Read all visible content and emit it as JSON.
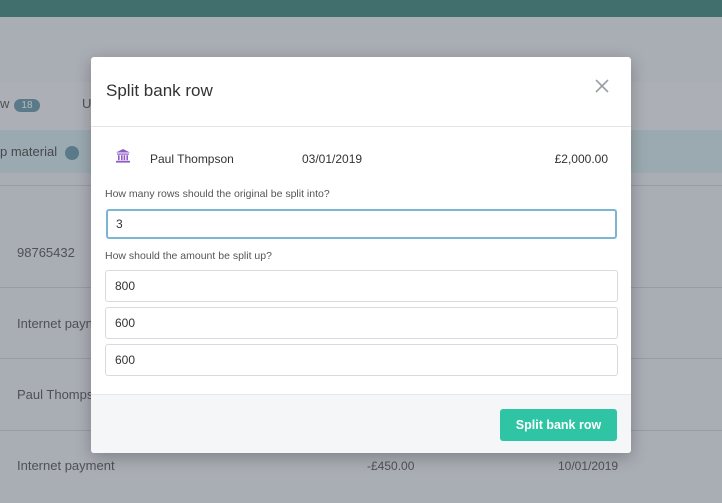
{
  "background": {
    "tabs": [
      {
        "label_fragment": "w",
        "count": "18"
      },
      {
        "label_fragment": "U"
      }
    ],
    "filter": {
      "label_fragment": "p material"
    },
    "rows": [
      {
        "description": "98765432"
      },
      {
        "description": "Internet payn"
      },
      {
        "description": "Paul Thomps"
      },
      {
        "description": "Internet payment",
        "amount": "-£450.00",
        "date": "10/01/2019"
      }
    ]
  },
  "modal": {
    "title": "Split bank row",
    "transaction": {
      "icon": "bank-icon",
      "name": "Paul Thompson",
      "date": "03/01/2019",
      "amount": "£2,000.00"
    },
    "rows_question": "How many rows should the original be split into?",
    "rows_value": "3",
    "amount_question": "How should the amount be split up?",
    "amounts": [
      "800",
      "600",
      "600"
    ],
    "submit_label": "Split bank row"
  },
  "colors": {
    "accent": "#2fc4a4",
    "topbar": "#2c7b6e",
    "focus_border": "#7ab6d1",
    "bank_icon": "#8e5bc7"
  }
}
